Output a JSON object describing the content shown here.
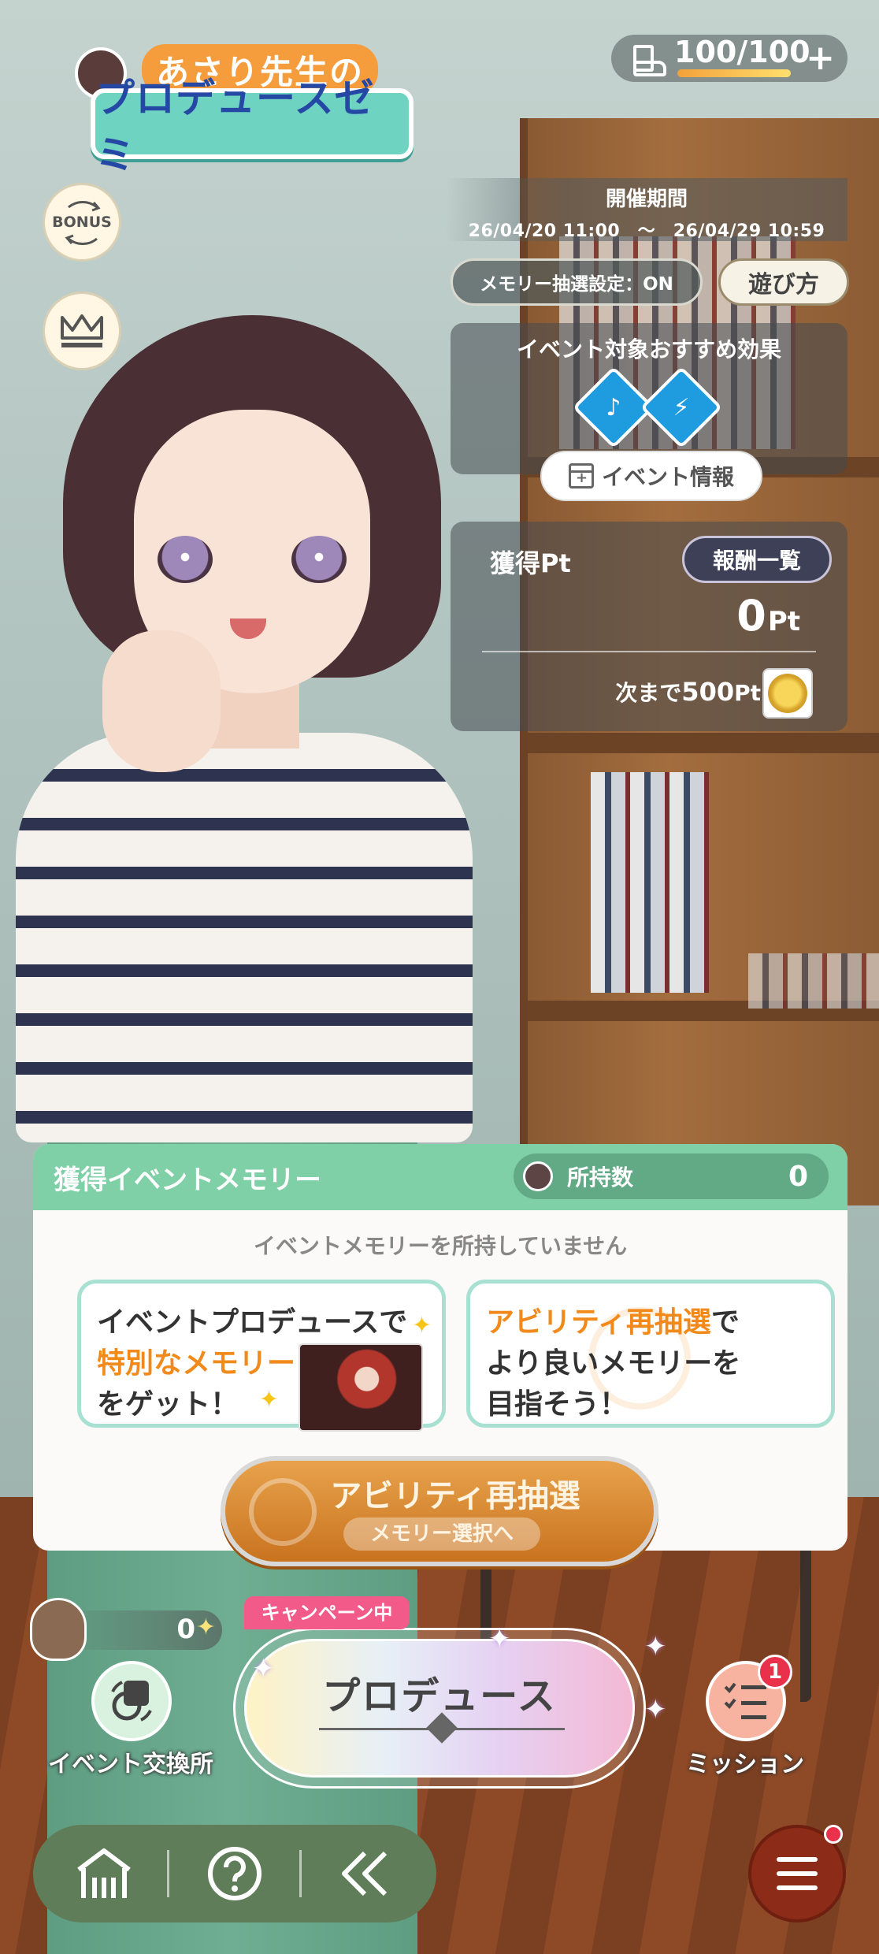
{
  "header": {
    "logo_line1": "あさり先生の",
    "logo_line2": "プロデュースゼミ",
    "stamina": "100/100",
    "stamina_fraction": 1.0,
    "stamina_add": "+"
  },
  "side_buttons": {
    "bonus_label": "BONUS"
  },
  "event": {
    "period_title": "開催期間",
    "period_dates": "26/04/20 11:00　～　26/04/29 10:59",
    "memory_setting": "メモリー抽選設定：ON",
    "how_to_play": "遊び方",
    "recommended_title": "イベント対象おすすめ効果",
    "event_info": "イベント情報"
  },
  "points": {
    "label": "獲得Pt",
    "reward_list": "報酬一覧",
    "value": "0",
    "unit": "Pt",
    "next_prefix": "次まで",
    "next_value": "500",
    "next_unit": "Pt"
  },
  "memory": {
    "title": "獲得イベントメモリー",
    "owned_label": "所持数",
    "owned_count": "0",
    "empty_message": "イベントメモリーを所持していません",
    "tip1_line1": "イベントプロデュースで",
    "tip1_line2": "特別なメモリー",
    "tip1_line3": "をゲット！",
    "tip2_line1_hl": "アビリティ再抽選",
    "tip2_line1": "で",
    "tip2_line2": "より良いメモリーを",
    "tip2_line3": "目指そう！",
    "reroll_main": "アビリティ再抽選",
    "reroll_sub": "メモリー選択へ"
  },
  "bottom": {
    "coin_count": "0",
    "exchange_label": "イベント交換所",
    "campaign": "キャンペーン中",
    "produce": "プロデュース",
    "mission_label": "ミッション",
    "mission_badge": "1"
  },
  "colors": {
    "accent_green": "#7fcfa7",
    "highlight_orange": "#f28a1b",
    "badge_red": "#e9314c",
    "nav_green": "#5e7d58"
  }
}
